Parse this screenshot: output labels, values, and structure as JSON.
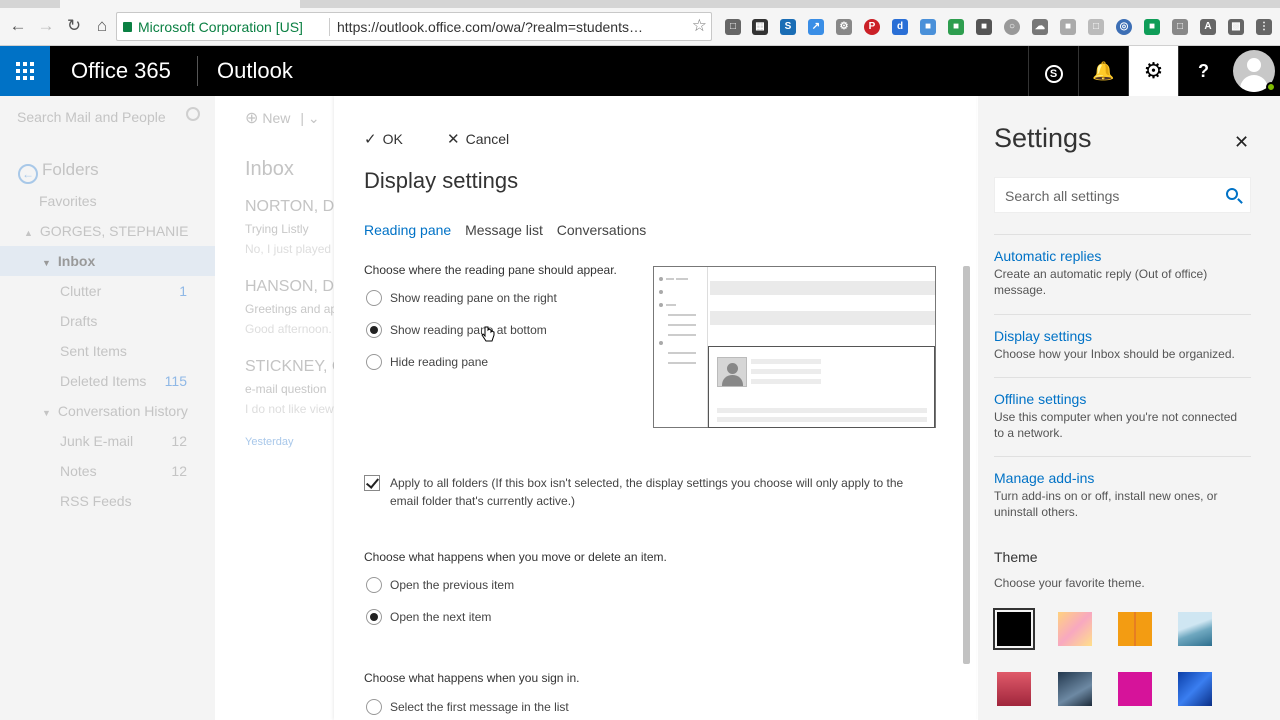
{
  "browser": {
    "secure_label": "Microsoft Corporation [US]",
    "url": "https://outlook.office.com/owa/?realm=students…"
  },
  "header": {
    "suite": "Office 365",
    "app": "Outlook"
  },
  "left_nav": {
    "search_placeholder": "Search Mail and People",
    "folders_label": "Folders",
    "items": [
      {
        "label": "Favorites",
        "count": ""
      },
      {
        "label": "GORGES, STEPHANIE",
        "count": ""
      },
      {
        "label": "Inbox",
        "count": ""
      },
      {
        "label": "Clutter",
        "count": "1"
      },
      {
        "label": "Drafts",
        "count": ""
      },
      {
        "label": "Sent Items",
        "count": ""
      },
      {
        "label": "Deleted Items",
        "count": "115"
      },
      {
        "label": "Conversation History",
        "count": ""
      },
      {
        "label": "Junk E-mail",
        "count": "12"
      },
      {
        "label": "Notes",
        "count": "12"
      },
      {
        "label": "RSS Feeds",
        "count": ""
      }
    ]
  },
  "msg_list": {
    "new_label": "New",
    "title": "Inbox",
    "messages": [
      {
        "from": "NORTON, D",
        "subject": "Trying Listly",
        "preview": "No, I just played a"
      },
      {
        "from": "HANSON, D",
        "subject": "Greetings and ap",
        "preview": "Good afternoon."
      },
      {
        "from": "STICKNEY, C",
        "subject": "e-mail question",
        "preview": "I do not like view"
      }
    ],
    "date_group": "Yesterday"
  },
  "dialog": {
    "ok_label": "OK",
    "cancel_label": "Cancel",
    "title": "Display settings",
    "tabs": [
      "Reading pane",
      "Message list",
      "Conversations"
    ],
    "reading_pane_prompt": "Choose where the reading pane should appear.",
    "reading_pane_options": [
      "Show reading pane on the right",
      "Show reading pane at bottom",
      "Hide reading pane"
    ],
    "apply_all_label": "Apply to all folders (If this box isn't selected, the display settings you choose will only apply to the email folder that's currently active.)",
    "move_delete_prompt": "Choose what happens when you move or delete an item.",
    "move_delete_options": [
      "Open the previous item",
      "Open the next item"
    ],
    "sign_in_prompt": "Choose what happens when you sign in.",
    "sign_in_options": [
      "Select the first message in the list"
    ]
  },
  "settings": {
    "title": "Settings",
    "search_placeholder": "Search all settings",
    "links": [
      {
        "label": "Automatic replies",
        "desc": "Create an automatic reply (Out of office) message."
      },
      {
        "label": "Display settings",
        "desc": "Choose how your Inbox should be organized."
      },
      {
        "label": "Offline settings",
        "desc": "Use this computer when you're not connected to a network."
      },
      {
        "label": "Manage add-ins",
        "desc": "Turn add-ins on or off, install new ones, or uninstall others."
      }
    ],
    "theme_label": "Theme",
    "theme_desc": "Choose your favorite theme."
  },
  "colors": {
    "accent": "#0072c6",
    "waffle_bg": "#0072c6",
    "header_bg": "#000000",
    "secure_green": "#0b8043"
  }
}
